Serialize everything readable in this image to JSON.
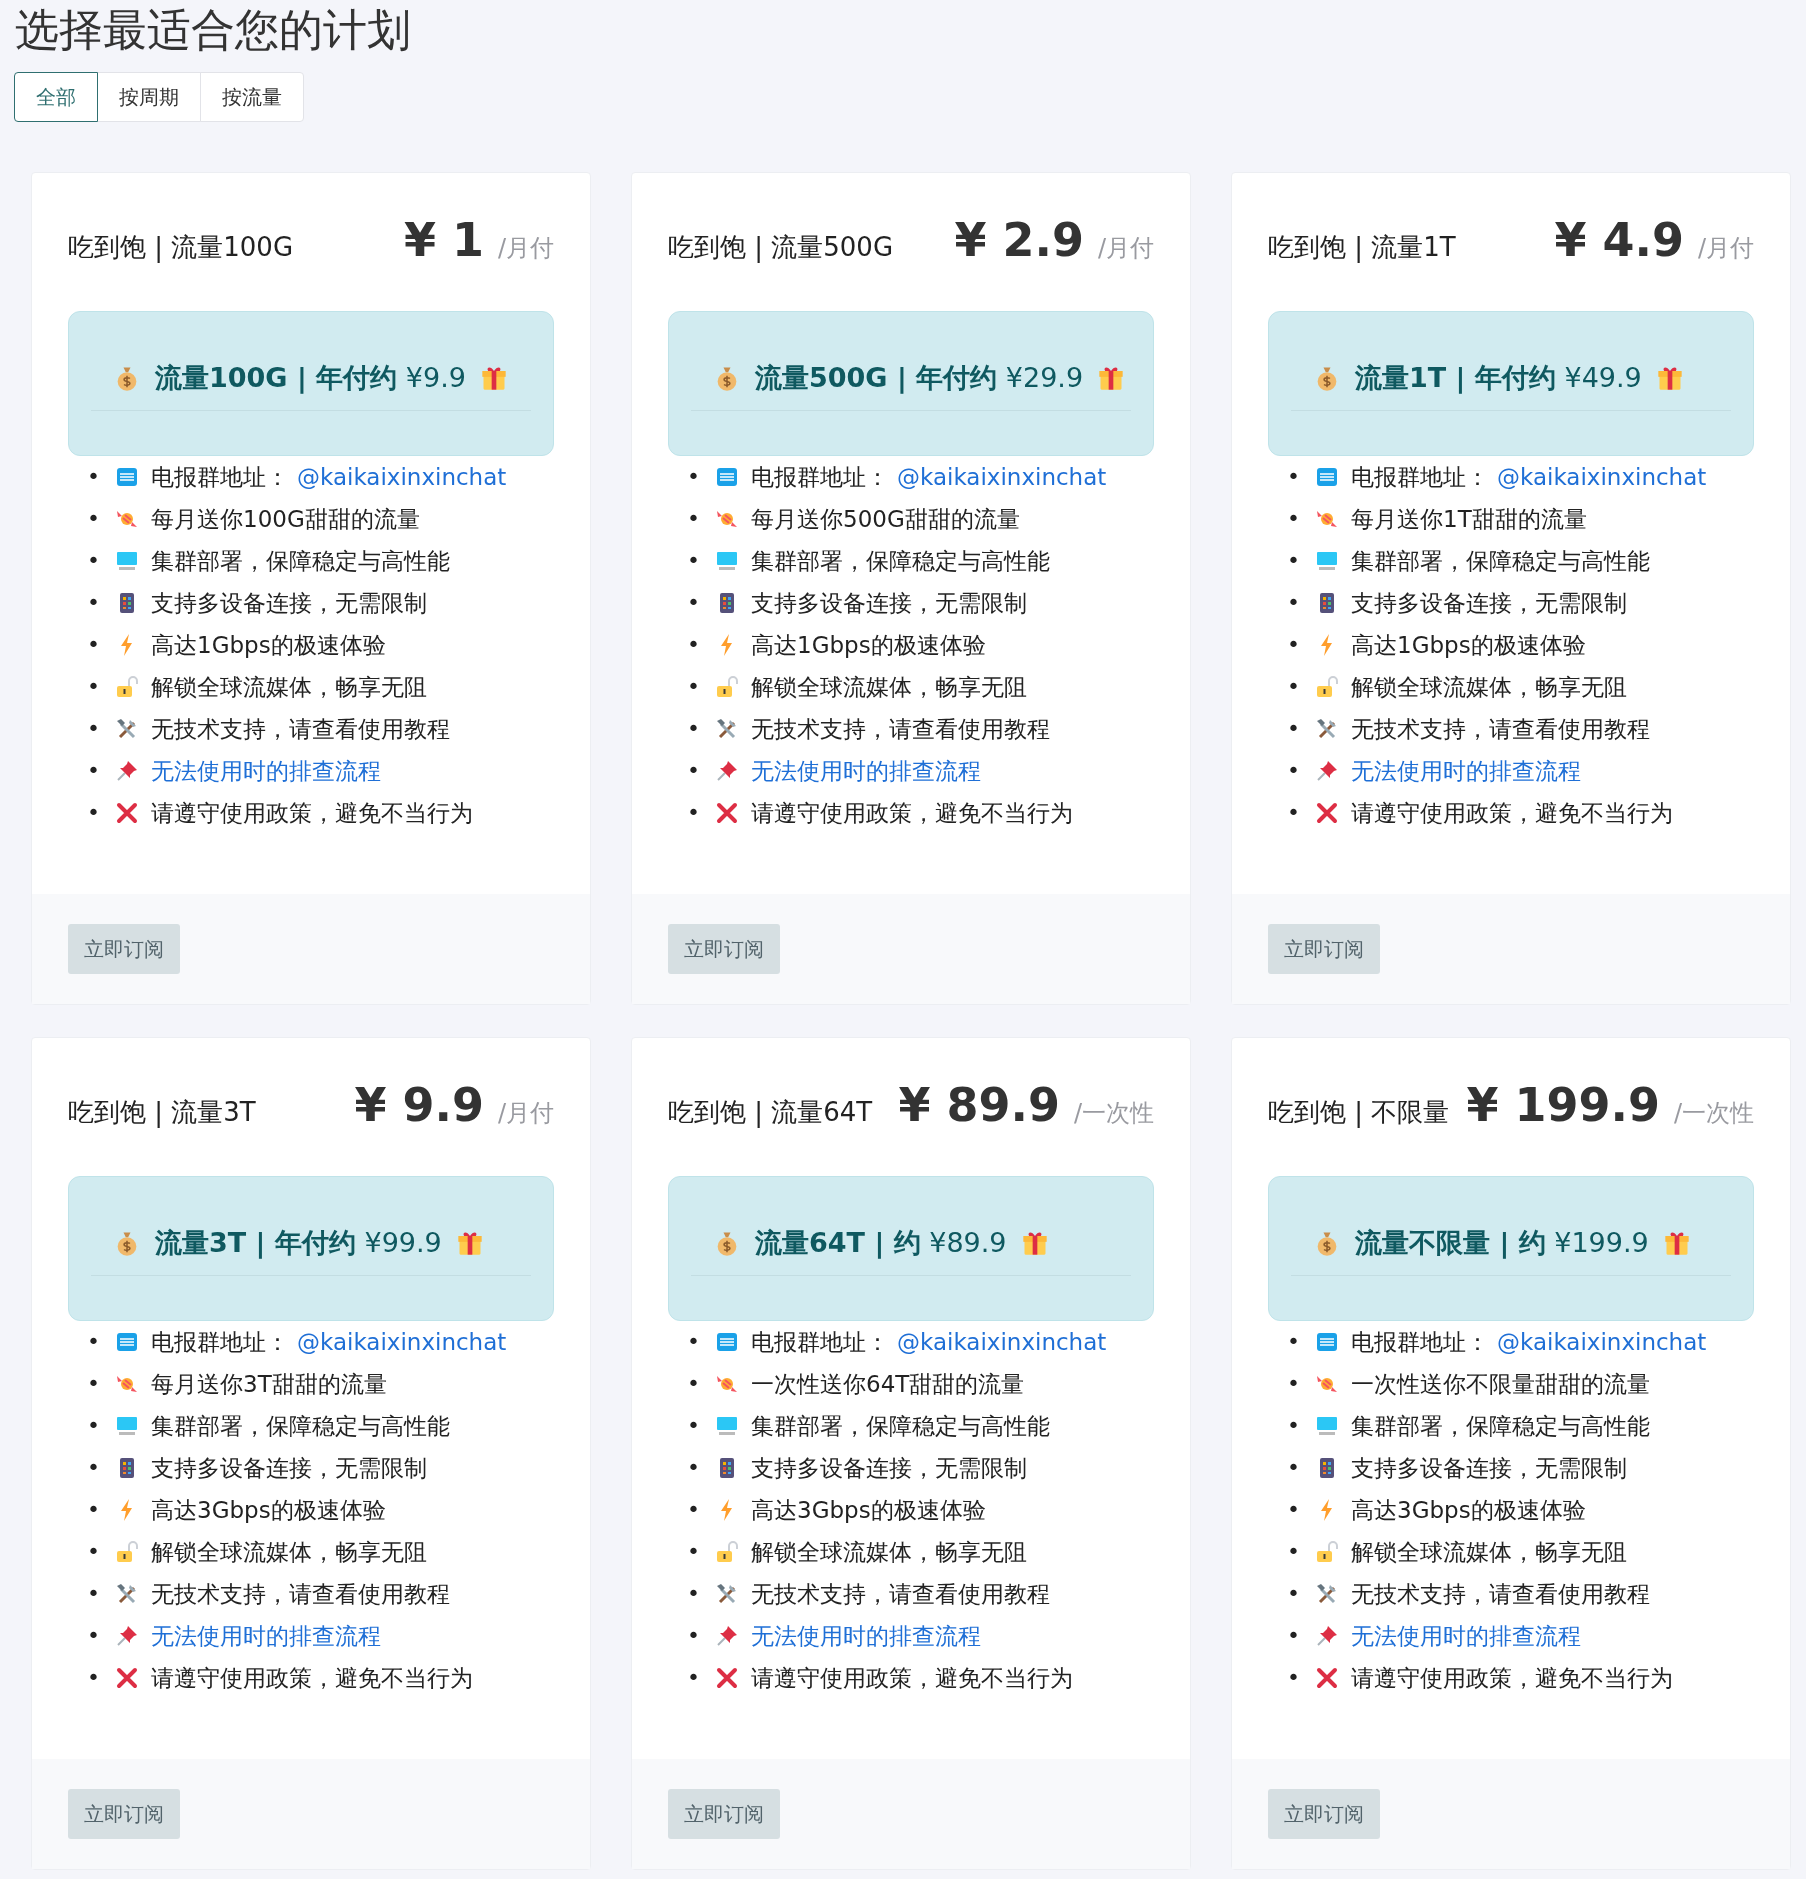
{
  "title": "选择最适合您的计划",
  "tabs": [
    {
      "label": "全部",
      "selected": true
    },
    {
      "label": "按周期",
      "selected": false
    },
    {
      "label": "按流量",
      "selected": false
    }
  ],
  "plans": [
    {
      "name": "吃到饱 | 流量100G",
      "price": "¥ 1",
      "period": "/月付",
      "offer": "**流量100G | 年付约** ¥9.9",
      "features": [
        {
          "kind": "free",
          "marker": "•",
          "text": "电报群地址：",
          "link": "@kaikaixinxinchat"
        },
        {
          "kind": "candy",
          "marker": "•",
          "text": "每月送你100G甜甜的流量"
        },
        {
          "kind": "monitor",
          "marker": "•",
          "text": "集群部署，保障稳定与高性能"
        },
        {
          "kind": "phone",
          "marker": "•",
          "text": "支持多设备连接，无需限制"
        },
        {
          "kind": "bolt",
          "marker": "•",
          "text": "高达1Gbps的极速体验"
        },
        {
          "kind": "lock",
          "marker": "•",
          "text": "解锁全球流媒体，畅享无阻"
        },
        {
          "kind": "tools",
          "marker": "•",
          "text": "无技术支持，请查看使用教程"
        },
        {
          "kind": "pin",
          "marker": "•",
          "link": "无法使用时的排查流程"
        },
        {
          "kind": "cross",
          "marker": "•",
          "text": "请遵守使用政策，避免不当行为"
        }
      ],
      "button": "立即订阅"
    },
    {
      "name": "吃到饱 | 流量500G",
      "price": "¥ 2.9",
      "period": "/月付",
      "offer": "**流量500G | 年付约** ¥29.9",
      "features": [
        {
          "kind": "free",
          "marker": "•",
          "text": "电报群地址：",
          "link": "@kaikaixinxinchat"
        },
        {
          "kind": "candy",
          "marker": "•",
          "text": "每月送你500G甜甜的流量"
        },
        {
          "kind": "monitor",
          "marker": "•",
          "text": "集群部署，保障稳定与高性能"
        },
        {
          "kind": "phone",
          "marker": "•",
          "text": "支持多设备连接，无需限制"
        },
        {
          "kind": "bolt",
          "marker": "•",
          "text": "高达1Gbps的极速体验"
        },
        {
          "kind": "lock",
          "marker": "•",
          "text": "解锁全球流媒体，畅享无阻"
        },
        {
          "kind": "tools",
          "marker": "•",
          "text": "无技术支持，请查看使用教程"
        },
        {
          "kind": "pin",
          "marker": "•",
          "link": "无法使用时的排查流程"
        },
        {
          "kind": "cross",
          "marker": "•",
          "text": "请遵守使用政策，避免不当行为"
        }
      ],
      "button": "立即订阅"
    },
    {
      "name": "吃到饱 | 流量1T",
      "price": "¥ 4.9",
      "period": "/月付",
      "offer": "**流量1T | 年付约** ¥49.9",
      "features": [
        {
          "kind": "free",
          "marker": "•",
          "text": "电报群地址：",
          "link": "@kaikaixinxinchat"
        },
        {
          "kind": "candy",
          "marker": "•",
          "text": "每月送你1T甜甜的流量"
        },
        {
          "kind": "monitor",
          "marker": "•",
          "text": "集群部署，保障稳定与高性能"
        },
        {
          "kind": "phone",
          "marker": "•",
          "text": "支持多设备连接，无需限制"
        },
        {
          "kind": "bolt",
          "marker": "•",
          "text": "高达1Gbps的极速体验"
        },
        {
          "kind": "lock",
          "marker": "•",
          "text": "解锁全球流媒体，畅享无阻"
        },
        {
          "kind": "tools",
          "marker": "•",
          "text": "无技术支持，请查看使用教程"
        },
        {
          "kind": "pin",
          "marker": "•",
          "link": "无法使用时的排查流程"
        },
        {
          "kind": "cross",
          "marker": "•",
          "text": "请遵守使用政策，避免不当行为"
        }
      ],
      "button": "立即订阅"
    },
    {
      "name": "吃到饱 | 流量3T",
      "price": "¥ 9.9",
      "period": "/月付",
      "offer": "**流量3T | 年付约** ¥99.9",
      "features": [
        {
          "kind": "free",
          "marker": "•",
          "text": "电报群地址：",
          "link": "@kaikaixinxinchat"
        },
        {
          "kind": "candy",
          "marker": "•",
          "text": "每月送你3T甜甜的流量"
        },
        {
          "kind": "monitor",
          "marker": "•",
          "text": "集群部署，保障稳定与高性能"
        },
        {
          "kind": "phone",
          "marker": "•",
          "text": "支持多设备连接，无需限制"
        },
        {
          "kind": "bolt",
          "marker": "•",
          "text": "高达3Gbps的极速体验"
        },
        {
          "kind": "lock",
          "marker": "•",
          "text": "解锁全球流媒体，畅享无阻"
        },
        {
          "kind": "tools",
          "marker": "•",
          "text": "无技术支持，请查看使用教程"
        },
        {
          "kind": "pin",
          "marker": "•",
          "link": "无法使用时的排查流程"
        },
        {
          "kind": "cross",
          "marker": "•",
          "text": "请遵守使用政策，避免不当行为"
        }
      ],
      "button": "立即订阅"
    },
    {
      "name": "吃到饱 | 流量64T",
      "price": "¥ 89.9",
      "period": "/一次性",
      "offer": "**流量64T | 约** ¥89.9",
      "features": [
        {
          "kind": "free",
          "marker": "•",
          "text": "电报群地址：",
          "link": "@kaikaixinxinchat"
        },
        {
          "kind": "candy",
          "marker": "•",
          "text": "一次性送你64T甜甜的流量"
        },
        {
          "kind": "monitor",
          "marker": "•",
          "text": "集群部署，保障稳定与高性能"
        },
        {
          "kind": "phone",
          "marker": "•",
          "text": "支持多设备连接，无需限制"
        },
        {
          "kind": "bolt",
          "marker": "•",
          "text": "高达3Gbps的极速体验"
        },
        {
          "kind": "lock",
          "marker": "•",
          "text": "解锁全球流媒体，畅享无阻"
        },
        {
          "kind": "tools",
          "marker": "•",
          "text": "无技术支持，请查看使用教程"
        },
        {
          "kind": "pin",
          "marker": "•",
          "link": "无法使用时的排查流程"
        },
        {
          "kind": "cross",
          "marker": "•",
          "text": "请遵守使用政策，避免不当行为"
        }
      ],
      "button": "立即订阅"
    },
    {
      "name": "吃到饱 | 不限量",
      "price": "¥ 199.9",
      "period": "/一次性",
      "offer": "**流量不限量 | 约** ¥199.9",
      "features": [
        {
          "kind": "free",
          "marker": "•",
          "text": "电报群地址：",
          "link": "@kaikaixinxinchat"
        },
        {
          "kind": "candy",
          "marker": "•",
          "text": "一次性送你不限量甜甜的流量"
        },
        {
          "kind": "monitor",
          "marker": "•",
          "text": "集群部署，保障稳定与高性能"
        },
        {
          "kind": "phone",
          "marker": "•",
          "text": "支持多设备连接，无需限制"
        },
        {
          "kind": "bolt",
          "marker": "•",
          "text": "高达3Gbps的极速体验"
        },
        {
          "kind": "lock",
          "marker": "•",
          "text": "解锁全球流媒体，畅享无阻"
        },
        {
          "kind": "tools",
          "marker": "•",
          "text": "无技术支持，请查看使用教程"
        },
        {
          "kind": "pin",
          "marker": "•",
          "link": "无法使用时的排查流程"
        },
        {
          "kind": "cross",
          "marker": "•",
          "text": "请遵守使用政策，避免不当行为"
        }
      ],
      "button": "立即订阅"
    }
  ]
}
